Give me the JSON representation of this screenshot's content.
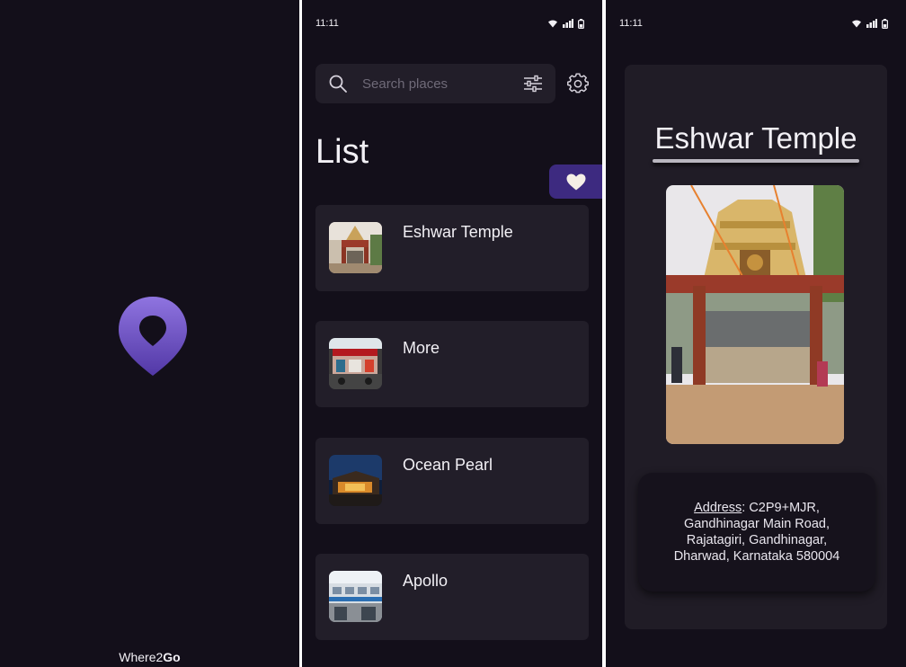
{
  "status_bar": {
    "time": "11:11"
  },
  "splash": {
    "brand_prefix": "Where2",
    "brand_suffix": "Go",
    "logo_icon": "map-pin-icon",
    "accent_color": "#7b5fd1"
  },
  "list_screen": {
    "search": {
      "placeholder": "Search places",
      "value": ""
    },
    "title": "List",
    "favorites_icon": "heart-icon",
    "places": [
      {
        "name": "Eshwar Temple"
      },
      {
        "name": "More"
      },
      {
        "name": "Ocean Pearl"
      },
      {
        "name": "Apollo"
      }
    ]
  },
  "detail_screen": {
    "title": "Eshwar Temple",
    "address_label": "Address",
    "address_lines": [
      ": C2P9+MJR,",
      "Gandhinagar Main Road,",
      "Rajatagiri, Gandhinagar,",
      "Dharwad, Karnataka 580004"
    ]
  },
  "colors": {
    "background": "#130f1a",
    "card": "#221e29",
    "favorites_tab": "#3d2a80"
  }
}
